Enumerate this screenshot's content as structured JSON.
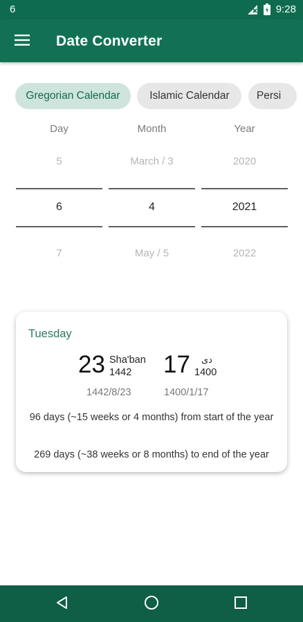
{
  "status_bar": {
    "notification": "6",
    "time": "9:28"
  },
  "app_bar": {
    "title": "Date Converter"
  },
  "tabs": [
    {
      "label": "Gregorian Calendar",
      "selected": true
    },
    {
      "label": "Islamic Calendar",
      "selected": false
    },
    {
      "label": "Persi",
      "selected": false
    }
  ],
  "picker": {
    "headers": {
      "day": "Day",
      "month": "Month",
      "year": "Year"
    },
    "day": {
      "prev": "5",
      "selected": "6",
      "next": "7"
    },
    "month": {
      "prev": "March / 3",
      "selected": "4",
      "next": "May / 5"
    },
    "year": {
      "prev": "2020",
      "selected": "2021",
      "next": "2022"
    }
  },
  "result_card": {
    "weekday": "Tuesday",
    "islamic": {
      "day": "23",
      "month_name": "Sha'ban",
      "year": "1442",
      "full": "1442/8/23"
    },
    "persian": {
      "day": "17",
      "month_name": "دی",
      "year": "1400",
      "full": "1400/1/17"
    },
    "summary_line1": "96 days (~15 weeks or 4 months) from start of the year",
    "summary_line2": "269 days (~38 weeks or 8 months) to end of the year"
  },
  "colors": {
    "primary": "#127155",
    "status_bar": "#0f6b4f",
    "chip_selected_bg": "#cfe4dc",
    "accent_text": "#2b7a62"
  },
  "icons": [
    "menu-icon",
    "signal-icon",
    "battery-icon",
    "back-icon",
    "home-icon",
    "recents-icon"
  ]
}
